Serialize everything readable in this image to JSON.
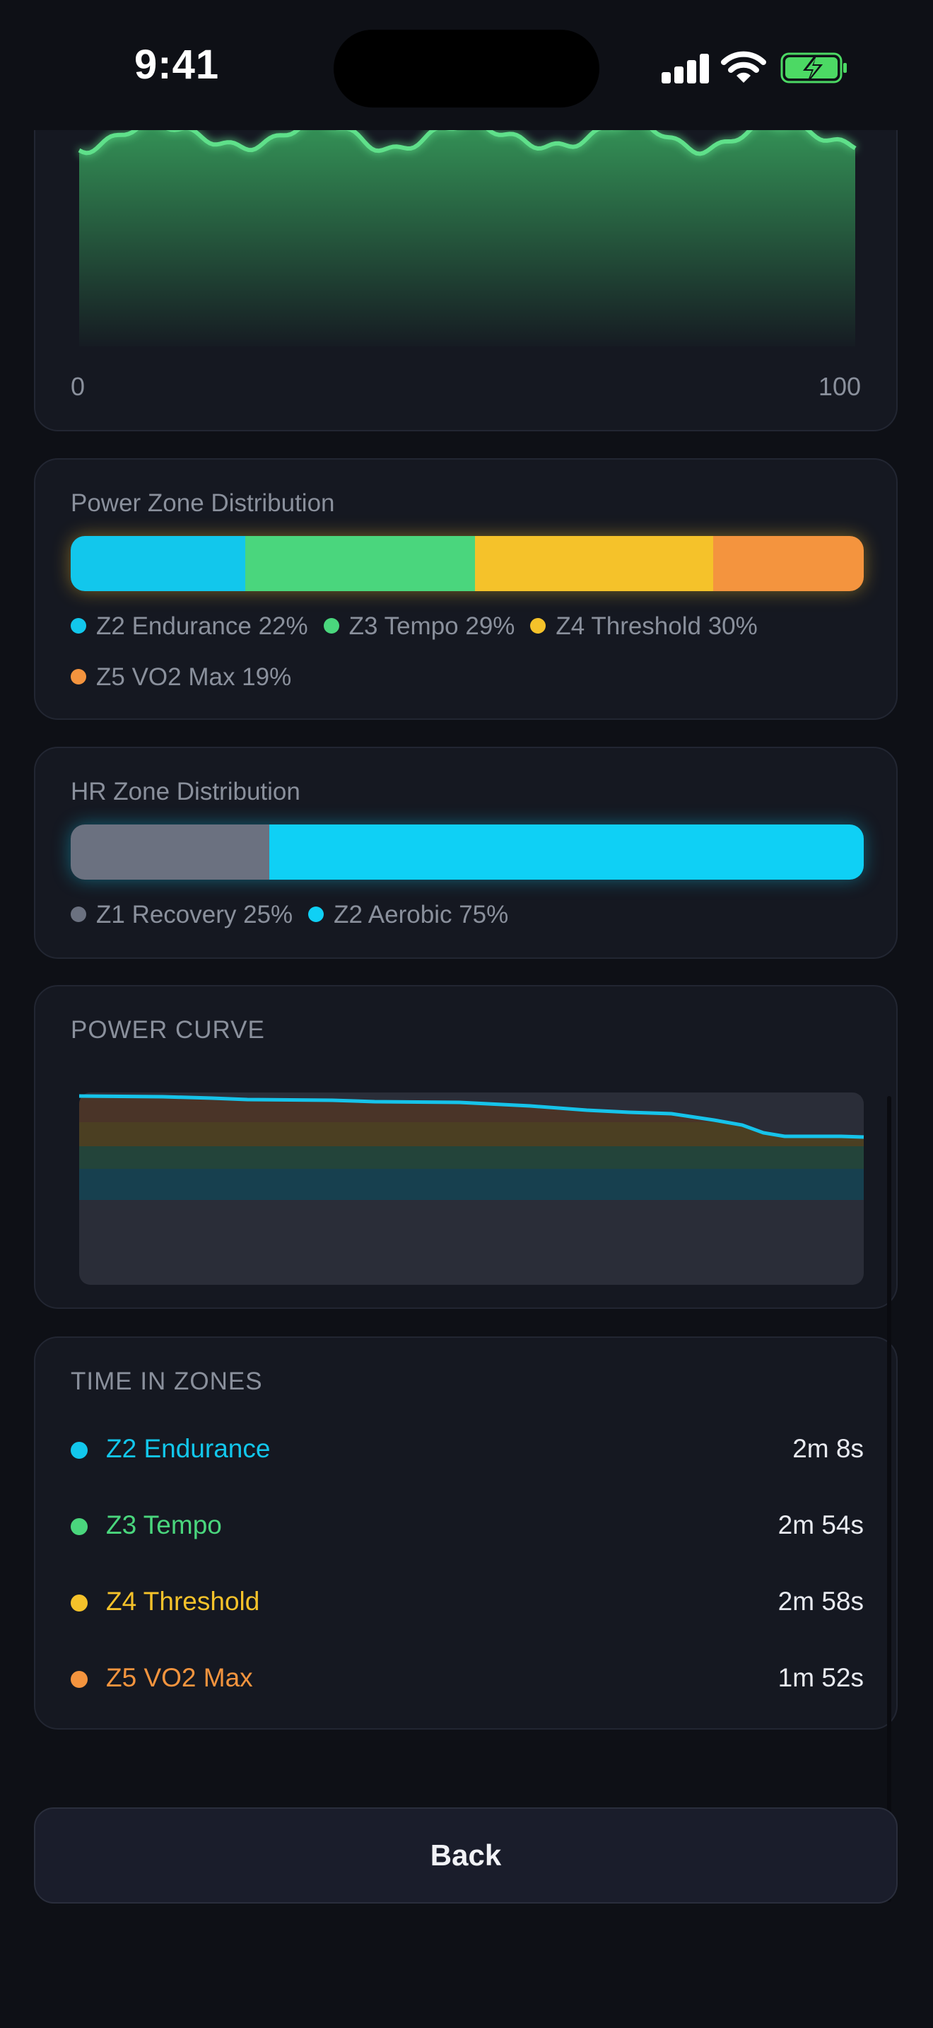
{
  "status_bar": {
    "time": "9:41"
  },
  "hr_chart": {
    "x_start": "0",
    "x_end": "100"
  },
  "power_zones": {
    "title": "Power Zone Distribution",
    "segments": [
      {
        "label": "Z2 Endurance 22%",
        "pct": 22,
        "color": "#12c7ec"
      },
      {
        "label": "Z3 Tempo 29%",
        "pct": 29,
        "color": "#4ad67d"
      },
      {
        "label": "Z4 Threshold 30%",
        "pct": 30,
        "color": "#f5c22a"
      },
      {
        "label": "Z5 VO2 Max 19%",
        "pct": 19,
        "color": "#f4943e"
      }
    ]
  },
  "hr_zones": {
    "title": "HR Zone Distribution",
    "segments": [
      {
        "label": "Z1 Recovery 25%",
        "pct": 25,
        "color": "#6b7180"
      },
      {
        "label": "Z2 Aerobic 75%",
        "pct": 75,
        "color": "#0fd0f5"
      }
    ]
  },
  "power_curve": {
    "title": "POWER CURVE"
  },
  "time_in_zones": {
    "title": "TIME IN ZONES",
    "rows": [
      {
        "name": "Z2 Endurance",
        "value": "2m 8s",
        "color": "#12c7ec"
      },
      {
        "name": "Z3 Tempo",
        "value": "2m 54s",
        "color": "#4ad67d"
      },
      {
        "name": "Z4 Threshold",
        "value": "2m 58s",
        "color": "#f5c22a"
      },
      {
        "name": "Z5 VO2 Max",
        "value": "1m 52s",
        "color": "#f4943e"
      }
    ]
  },
  "back_button": {
    "label": "Back"
  }
}
